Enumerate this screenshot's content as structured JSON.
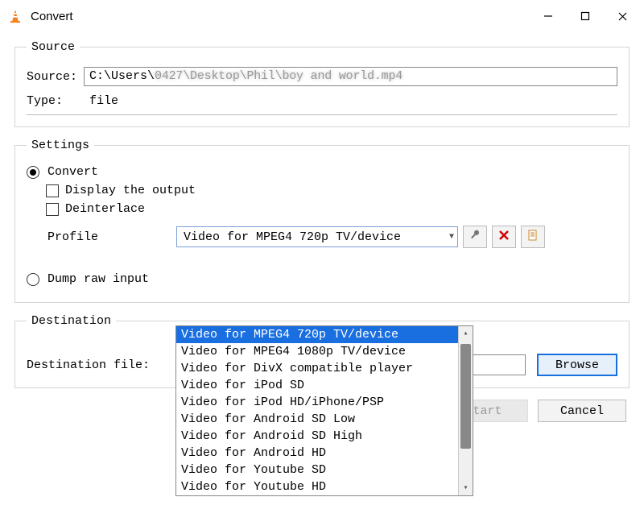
{
  "window": {
    "title": "Convert"
  },
  "source": {
    "legend": "Source",
    "label": "Source:",
    "path_visible": "C:\\Users\\",
    "path_blurred": "0427\\Desktop\\Phil\\boy and world.mp4",
    "type_label": "Type:",
    "type_value": "file"
  },
  "settings": {
    "legend": "Settings",
    "convert_label": "Convert",
    "display_output_label": "Display the output",
    "deinterlace_label": "Deinterlace",
    "profile_label": "Profile",
    "profile_selected": "Video for MPEG4 720p TV/device",
    "profile_options": [
      "Video for MPEG4 720p TV/device",
      "Video for MPEG4 1080p TV/device",
      "Video for DivX compatible player",
      "Video for iPod SD",
      "Video for iPod HD/iPhone/PSP",
      "Video for Android SD Low",
      "Video for Android SD High",
      "Video for Android HD",
      "Video for Youtube SD",
      "Video for Youtube HD"
    ],
    "dump_raw_label": "Dump raw input"
  },
  "destination": {
    "legend": "Destination",
    "label": "Destination file:",
    "value": "",
    "browse_label": "Browse"
  },
  "buttons": {
    "start": "Start",
    "cancel": "Cancel"
  }
}
